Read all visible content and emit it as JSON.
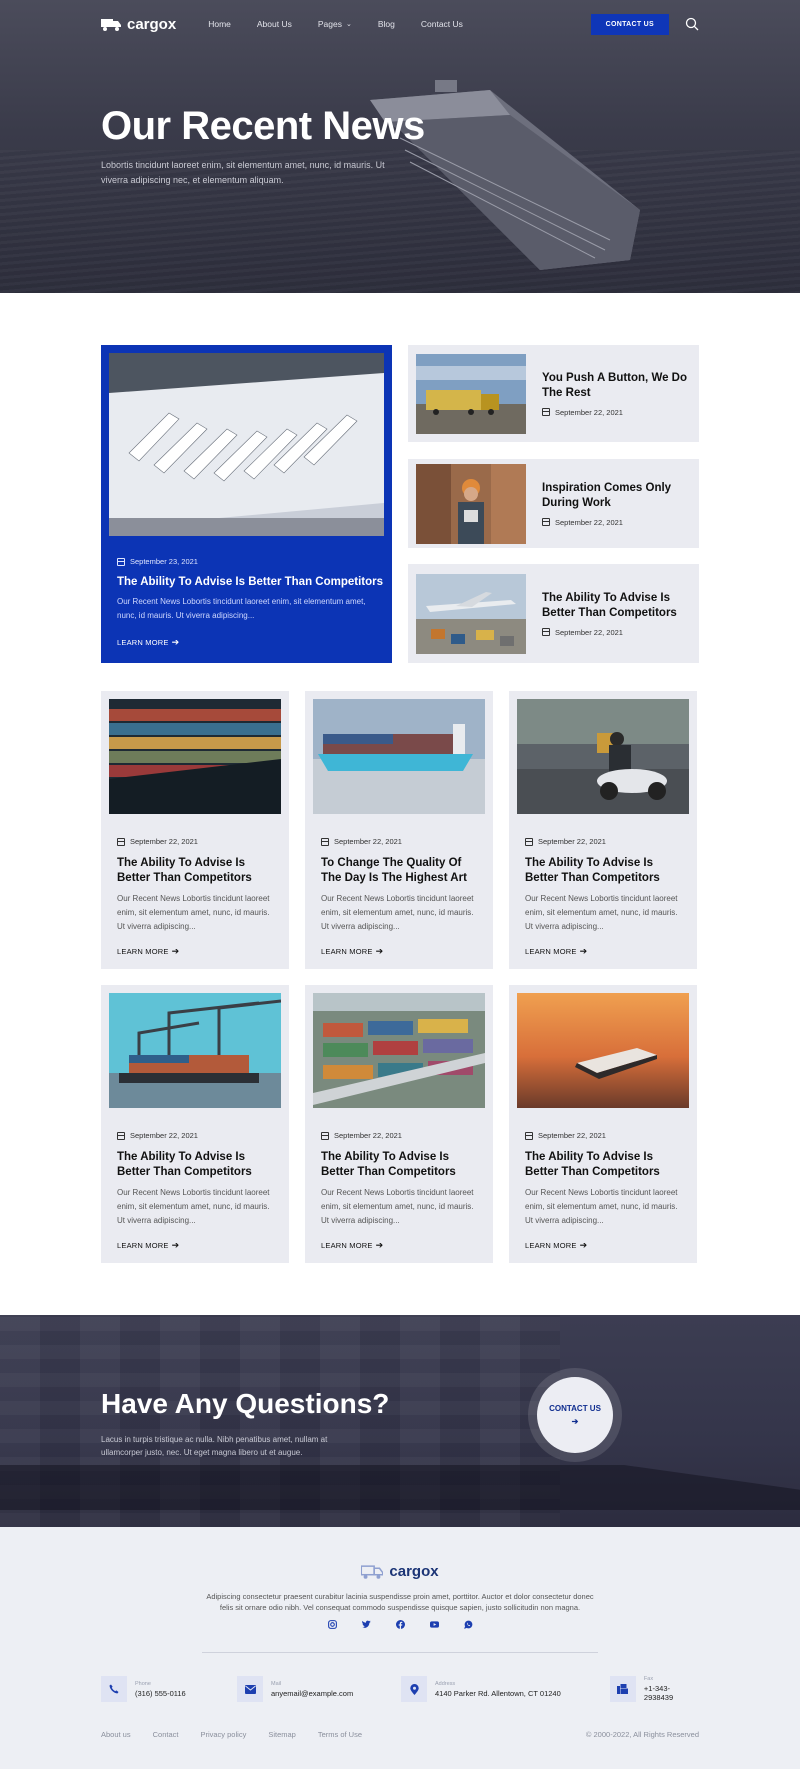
{
  "nav": {
    "logo": "cargox",
    "menu": [
      {
        "label": "Home"
      },
      {
        "label": "About Us"
      },
      {
        "label": "Pages"
      },
      {
        "label": "Blog"
      },
      {
        "label": "Contact Us"
      }
    ],
    "cta": "CONTACT US"
  },
  "hero": {
    "title": "Our Recent News",
    "subtitle": "Lobortis tincidunt laoreet enim, sit elementum amet, nunc, id mauris. Ut viverra adipiscing nec, et elementum aliquam."
  },
  "featured": {
    "date": "September 23, 2021",
    "title": "The Ability To Advise Is Better Than Competitors",
    "excerpt": "Our Recent News Lobortis tincidunt laoreet enim, sit elementum amet, nunc, id mauris. Ut viverra adipiscing...",
    "link": "LEARN MORE"
  },
  "side_posts": [
    {
      "title": "You Push A Button, We Do The Rest",
      "date": "September 22, 2021"
    },
    {
      "title": "Inspiration Comes Only During Work",
      "date": "September 22, 2021"
    },
    {
      "title": "The Ability To Advise Is Better Than Competitors",
      "date": "September 22, 2021"
    }
  ],
  "posts": [
    {
      "title": "The Ability To Advise Is Better Than Competitors",
      "date": "September 22, 2021",
      "excerpt": "Our Recent News Lobortis tincidunt laoreet enim, sit elementum amet, nunc, id mauris. Ut viverra adipiscing...",
      "link": "LEARN MORE"
    },
    {
      "title": "To Change The Quality Of The Day Is The Highest Art",
      "date": "September 22, 2021",
      "excerpt": "Our Recent News Lobortis tincidunt laoreet enim, sit elementum amet, nunc, id mauris. Ut viverra adipiscing...",
      "link": "LEARN MORE"
    },
    {
      "title": "The Ability To Advise Is Better Than Competitors",
      "date": "September 22, 2021",
      "excerpt": "Our Recent News Lobortis tincidunt laoreet enim, sit elementum amet, nunc, id mauris. Ut viverra adipiscing...",
      "link": "LEARN MORE"
    },
    {
      "title": "The Ability To Advise Is Better Than Competitors",
      "date": "September 22, 2021",
      "excerpt": "Our Recent News Lobortis tincidunt laoreet enim, sit elementum amet, nunc, id mauris. Ut viverra adipiscing...",
      "link": "LEARN MORE"
    },
    {
      "title": "The Ability To Advise Is Better Than Competitors",
      "date": "September 22, 2021",
      "excerpt": "Our Recent News Lobortis tincidunt laoreet enim, sit elementum amet, nunc, id mauris. Ut viverra adipiscing...",
      "link": "LEARN MORE"
    },
    {
      "title": "The Ability To Advise Is Better Than Competitors",
      "date": "September 22, 2021",
      "excerpt": "Our Recent News Lobortis tincidunt laoreet enim, sit elementum amet, nunc, id mauris. Ut viverra adipiscing...",
      "link": "LEARN MORE"
    }
  ],
  "cta_section": {
    "title": "Have Any Questions?",
    "text": "Lacus in turpis tristique ac nulla. Nibh penatibus amet, nullam at ullamcorper justo, nec. Ut eget magna libero ut et augue.",
    "button": "CONTACT US"
  },
  "footer": {
    "logo": "cargox",
    "description": "Adipiscing consectetur praesent curabitur lacinia suspendisse proin amet, porttitor. Auctor et dolor consectetur donec felis sit ornare odio nibh. Vel consequat commodo suspendisse quisque sapien, justo sollicitudin non magna.",
    "socials": [
      "instagram-icon",
      "twitter-icon",
      "facebook-icon",
      "youtube-icon",
      "whatsapp-icon"
    ],
    "contacts": [
      {
        "label": "Phone",
        "value": "(316) 555-0116"
      },
      {
        "label": "Mail",
        "value": "anyemail@example.com"
      },
      {
        "label": "Address",
        "value": "4140 Parker Rd. Allentown, CT 01240"
      },
      {
        "label": "Fax",
        "value": "+1-343-2938439"
      }
    ],
    "links": [
      "About us",
      "Contact",
      "Privacy policy",
      "Sitemap",
      "Terms of Use"
    ],
    "copyright": "© 2000-2022, All Rights Reserved"
  },
  "colors": {
    "accent": "#0c34b5",
    "card_bg": "#eaebf1",
    "footer_bg": "#edeff4"
  }
}
